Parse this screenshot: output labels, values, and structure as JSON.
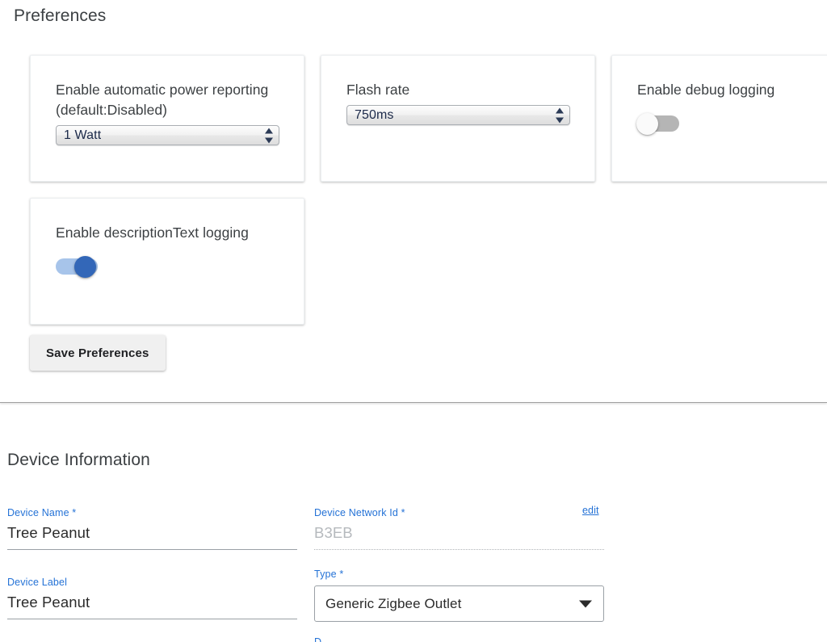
{
  "preferences": {
    "title": "Preferences",
    "cards": [
      {
        "label": "Enable automatic power reporting (default:Disabled)",
        "control": "select",
        "value": "1 Watt"
      },
      {
        "label": "Flash rate",
        "control": "select",
        "value": "750ms"
      },
      {
        "label": "Enable debug logging",
        "control": "toggle",
        "state": "off"
      },
      {
        "label": "Enable descriptionText logging",
        "control": "toggle",
        "state": "on"
      }
    ],
    "save_label": "Save Preferences"
  },
  "device_information": {
    "title": "Device Information",
    "edit_label": "edit",
    "fields": {
      "device_name": {
        "label": "Device Name *",
        "value": "Tree Peanut"
      },
      "device_label": {
        "label": "Device Label",
        "value": "Tree Peanut"
      },
      "device_network_id": {
        "label": "Device Network Id *",
        "value": "B3EB"
      },
      "type": {
        "label": "Type *",
        "value": "Generic Zigbee Outlet"
      },
      "partial_next": {
        "label": "D"
      }
    }
  },
  "colors": {
    "link_blue": "#2472d6",
    "toggle_on_track": "#a7c4ea",
    "toggle_on_knob": "#3367b8",
    "toggle_off_track": "#b5b5b5",
    "heading": "#3c4043"
  }
}
